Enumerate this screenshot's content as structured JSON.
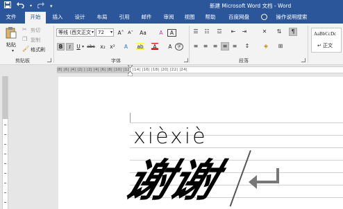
{
  "window": {
    "title": "新建 Microsoft Word 文档 - Word",
    "qat": {
      "save_icon": "save-icon",
      "undo_icon": "undo-icon",
      "redo_icon": "redo-icon",
      "customize": "customize-qat-icon"
    }
  },
  "tabs": [
    {
      "label": "文件"
    },
    {
      "label": "开始"
    },
    {
      "label": "插入"
    },
    {
      "label": "设计"
    },
    {
      "label": "布局"
    },
    {
      "label": "引用"
    },
    {
      "label": "邮件"
    },
    {
      "label": "审阅"
    },
    {
      "label": "视图"
    },
    {
      "label": "帮助"
    },
    {
      "label": "百度网盘"
    },
    {
      "label": "操作说明搜索"
    }
  ],
  "ribbon": {
    "clipboard": {
      "paste_label": "粘贴",
      "cut_label": "剪切",
      "copy_label": "复制",
      "format_painter_label": "格式刷",
      "group_label": "剪贴板"
    },
    "font": {
      "font_name": "等线 (西文正文",
      "font_size": "72",
      "grow_label": "A˄",
      "shrink_label": "A˅",
      "case_label": "Aa",
      "clear_label": "A",
      "bold": "B",
      "italic": "I",
      "underline": "U",
      "strike": "abc",
      "subscript": "x₂",
      "superscript": "x²",
      "text_effects": "A",
      "highlight": "ab",
      "font_color": "A",
      "phonetic": "wén",
      "border": "A",
      "enclose": "字",
      "group_label": "字体"
    },
    "paragraph": {
      "group_label": "段落"
    },
    "styles": {
      "preview_text": "AaBbCcDc",
      "style_name": "↵ 正文"
    }
  },
  "ruler": {
    "numbers": "|8|  |6|  |4|  |2|  |  |2|  |4|  |6|  |8|  |10|  |12|  |14|  |16|  |18|  |20|  |22|  |24|"
  },
  "document": {
    "pinyin": "xièxiè",
    "hanzi": "谢谢",
    "paragraph_mark": "↵"
  },
  "colors": {
    "word_blue": "#2b579a",
    "ribbon_bg": "#f3f3f3",
    "highlight_yellow": "#ffff00",
    "font_color_red": "#ff0000"
  }
}
